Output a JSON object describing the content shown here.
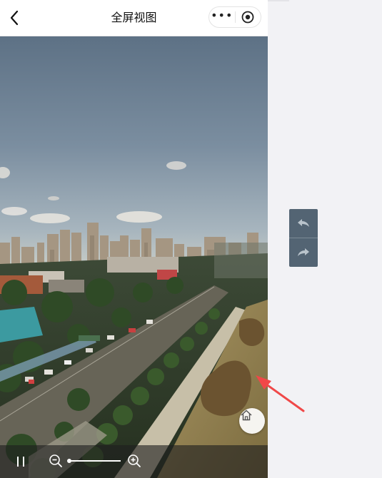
{
  "header": {
    "title": "全屏视图",
    "back_icon": "chevron-left-icon",
    "more_icon": "more-dots-icon",
    "more_glyph": "•••",
    "close_icon": "target-circle-icon"
  },
  "panorama": {
    "scene": "city-aerial-panorama",
    "home_icon": "home-icon"
  },
  "controls": {
    "pause_icon": "pause-icon",
    "zoom_out_icon": "zoom-out-icon",
    "zoom_in_icon": "zoom-in-icon",
    "zoom_level": 0
  },
  "side_panel": {
    "undo_icon": "undo-arrow-icon",
    "redo_icon": "redo-arrow-icon"
  },
  "colors": {
    "annotation_arrow": "#f04848",
    "side_panel": "#536473",
    "control_bar": "#1e1e1e"
  }
}
